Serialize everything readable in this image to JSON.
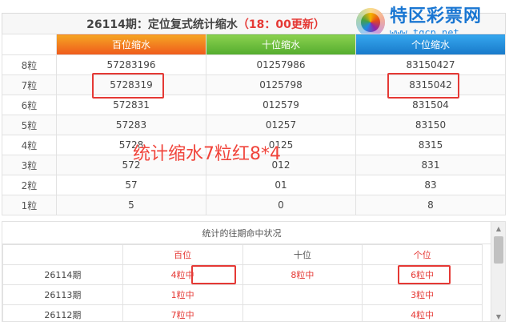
{
  "header": {
    "title_main": "26114期：定位复式统计缩水",
    "title_highlight": "（18：00更新）"
  },
  "logo": {
    "brand": "特区彩票网",
    "url": "www.tqcp.net",
    "icon": "swirl-logo-icon"
  },
  "columns": [
    "百位缩水",
    "十位缩水",
    "个位缩水"
  ],
  "rows": [
    {
      "label": "8粒",
      "hundreds": "57283196",
      "tens": "01257986",
      "units": "83150427"
    },
    {
      "label": "7粒",
      "hundreds": "5728319",
      "tens": "0125798",
      "units": "8315042"
    },
    {
      "label": "6粒",
      "hundreds": "572831",
      "tens": "012579",
      "units": "831504"
    },
    {
      "label": "5粒",
      "hundreds": "57283",
      "tens": "01257",
      "units": "83150"
    },
    {
      "label": "4粒",
      "hundreds": "5728",
      "tens": "0125",
      "units": "8315"
    },
    {
      "label": "3粒",
      "hundreds": "572",
      "tens": "012",
      "units": "831"
    },
    {
      "label": "2粒",
      "hundreds": "57",
      "tens": "01",
      "units": "83"
    },
    {
      "label": "1粒",
      "hundreds": "5",
      "tens": "0",
      "units": "8"
    }
  ],
  "overlay_text": "统计缩水7粒红8*4",
  "history": {
    "title": "统计的往期命中状况",
    "columns": [
      "",
      "百位",
      "十位",
      "个位"
    ],
    "rows": [
      {
        "period": "26114期",
        "hundreds": "4粒中",
        "tens": "8粒中",
        "units": "6粒中"
      },
      {
        "period": "26113期",
        "hundreds": "1粒中",
        "tens": "",
        "units": "3粒中"
      },
      {
        "period": "26112期",
        "hundreds": "7粒中",
        "tens": "",
        "units": "4粒中"
      }
    ]
  },
  "colors": {
    "accent_red": "#e53935",
    "hundreds_header": "#ef5a1c",
    "tens_header": "#54ac2e",
    "units_header": "#1879c9"
  }
}
